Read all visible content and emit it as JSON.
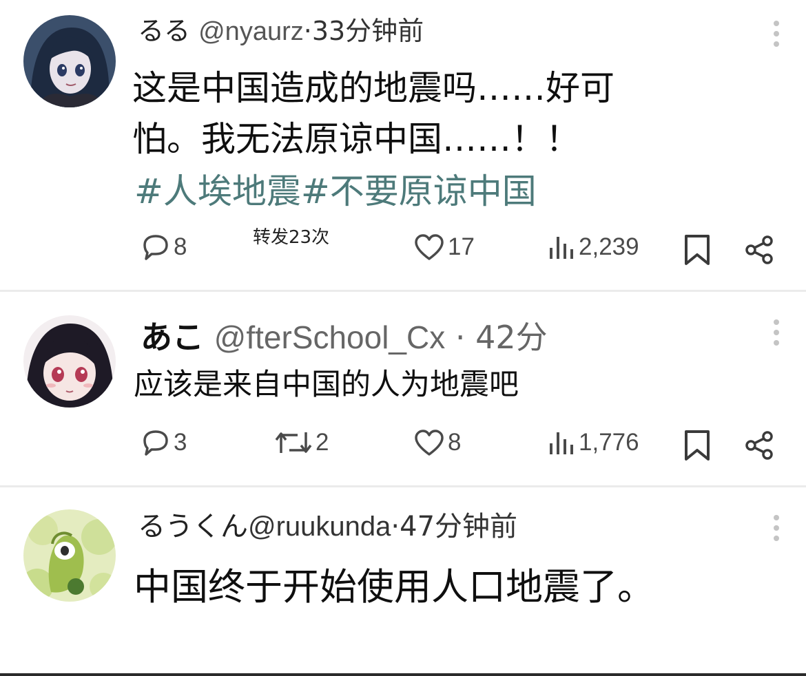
{
  "posts": [
    {
      "name": "るる",
      "handle": "@nyaurz",
      "time": "·33分钟前",
      "text_lines": [
        "这是中国造成的地震吗……好可",
        "怕。我无法原谅中国……！！"
      ],
      "hashtags": "#人埃地震#不要原谅中国",
      "repost_note": "转发23次",
      "actions": {
        "replies": "8",
        "likes": "17",
        "views": "2,239"
      },
      "avatar_icon": "anime-girl-dark-hair-avatar"
    },
    {
      "name": "あこ",
      "handle": "@fterSchool_Cx",
      "time": "· 42分",
      "text_lines": [
        "应该是来自中国的人为地震吧"
      ],
      "actions": {
        "replies": "3",
        "reposts": "2",
        "likes": "8",
        "views": "1,776"
      },
      "avatar_icon": "anime-girl-pink-eyes-avatar"
    },
    {
      "name": "るうくん",
      "handle": "@ruukunda",
      "time": "·47分钟前",
      "text_lines": [
        "中国终于开始使用人口地震了。"
      ],
      "avatar_icon": "green-creature-avatar"
    }
  ],
  "colors": {
    "hashtag": "#4d7a7a",
    "icon": "#4a4a4a",
    "divider": "#ebebeb"
  },
  "icons": [
    "reply-icon",
    "repost-icon",
    "like-icon",
    "views-icon",
    "bookmark-icon",
    "share-icon",
    "more-options-icon"
  ]
}
